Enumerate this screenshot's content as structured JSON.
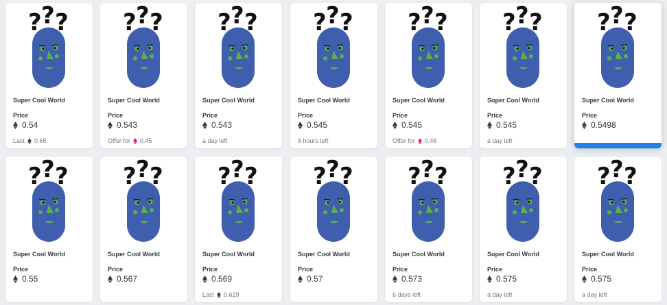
{
  "collection_name": "Super Cool World",
  "price_label": "Price",
  "colors": {
    "accent": "#2081e2",
    "head": "#3f5fae",
    "feature": "#5bb04d",
    "eth_gray": "#353840",
    "eth_pink": "#e2107b"
  },
  "cards": [
    {
      "price": "0.54",
      "meta_prefix": "Last",
      "meta_value": "0.65",
      "meta_icon": "eth-gray"
    },
    {
      "price": "0.543",
      "meta_prefix": "Offer for",
      "meta_value": "0.45",
      "meta_icon": "eth-pink"
    },
    {
      "price": "0.543",
      "meta_prefix": "a day left",
      "meta_value": "",
      "meta_icon": ""
    },
    {
      "price": "0.545",
      "meta_prefix": "8 hours left",
      "meta_value": "",
      "meta_icon": ""
    },
    {
      "price": "0.545",
      "meta_prefix": "Offer for",
      "meta_value": "0.46",
      "meta_icon": "eth-pink"
    },
    {
      "price": "0.545",
      "meta_prefix": "a day left",
      "meta_value": "",
      "meta_icon": ""
    },
    {
      "price": "0.5498",
      "meta_prefix": "",
      "meta_value": "",
      "meta_icon": "",
      "hovered": true
    },
    {
      "price": "0.55",
      "meta_prefix": "",
      "meta_value": "",
      "meta_icon": ""
    },
    {
      "price": "0.567",
      "meta_prefix": "",
      "meta_value": "",
      "meta_icon": ""
    },
    {
      "price": "0.569",
      "meta_prefix": "Last",
      "meta_value": "0.629",
      "meta_icon": "eth-gray"
    },
    {
      "price": "0.57",
      "meta_prefix": "",
      "meta_value": "",
      "meta_icon": ""
    },
    {
      "price": "0.573",
      "meta_prefix": "6 days left",
      "meta_value": "",
      "meta_icon": ""
    },
    {
      "price": "0.575",
      "meta_prefix": "a day left",
      "meta_value": "",
      "meta_icon": ""
    },
    {
      "price": "0.575",
      "meta_prefix": "a day left",
      "meta_value": "",
      "meta_icon": ""
    }
  ]
}
